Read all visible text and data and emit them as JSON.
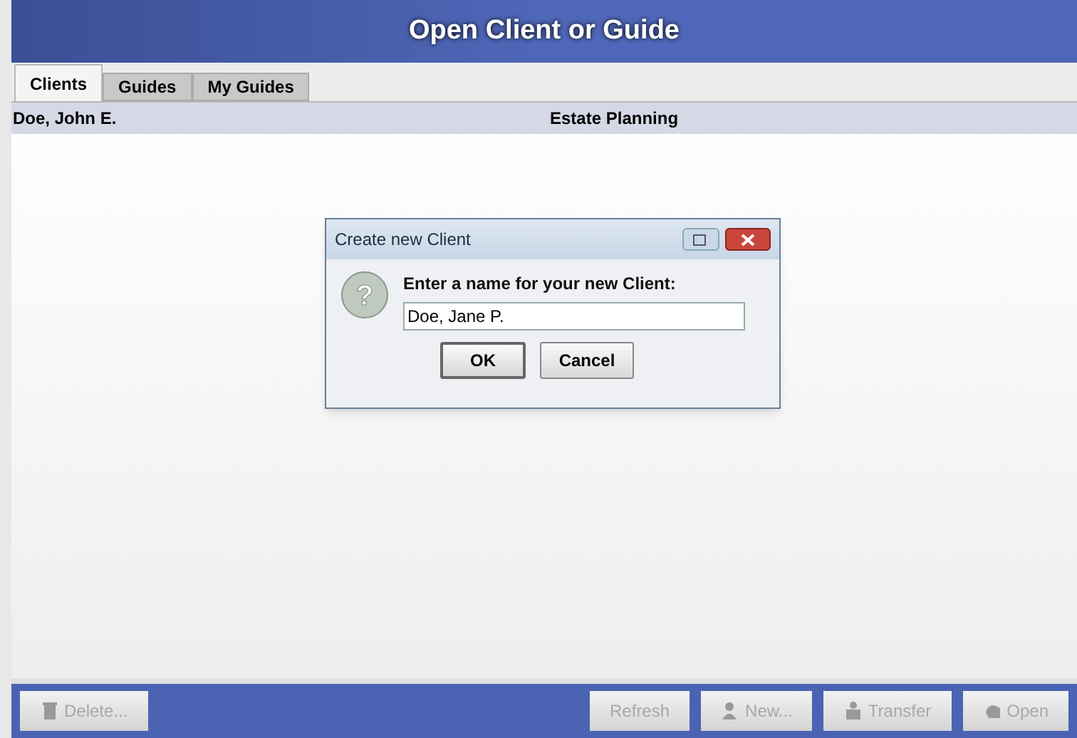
{
  "window": {
    "title": "Open Client or Guide"
  },
  "tabs": [
    {
      "label": "Clients",
      "selected": true
    },
    {
      "label": "Guides",
      "selected": false
    },
    {
      "label": "My Guides",
      "selected": false
    }
  ],
  "table": {
    "rows": [
      {
        "name": "Doe, John E.",
        "guide": "Estate Planning",
        "selected": true
      }
    ]
  },
  "dialog": {
    "icon": "?",
    "title": "Create new Client",
    "prompt": "Enter a name for your new Client:",
    "value": "Doe, Jane P.",
    "buttons": [
      "OK",
      "Cancel"
    ]
  },
  "buttons": [
    {
      "label": "Delete...",
      "kind": "trash",
      "disabled": true
    },
    {
      "label": "Refresh",
      "kind": "none",
      "disabled": true
    },
    {
      "label": "New...",
      "kind": "person",
      "disabled": true
    },
    {
      "label": "Transfer",
      "kind": "people",
      "disabled": true
    },
    {
      "label": "Open",
      "kind": "hand",
      "disabled": true
    }
  ]
}
